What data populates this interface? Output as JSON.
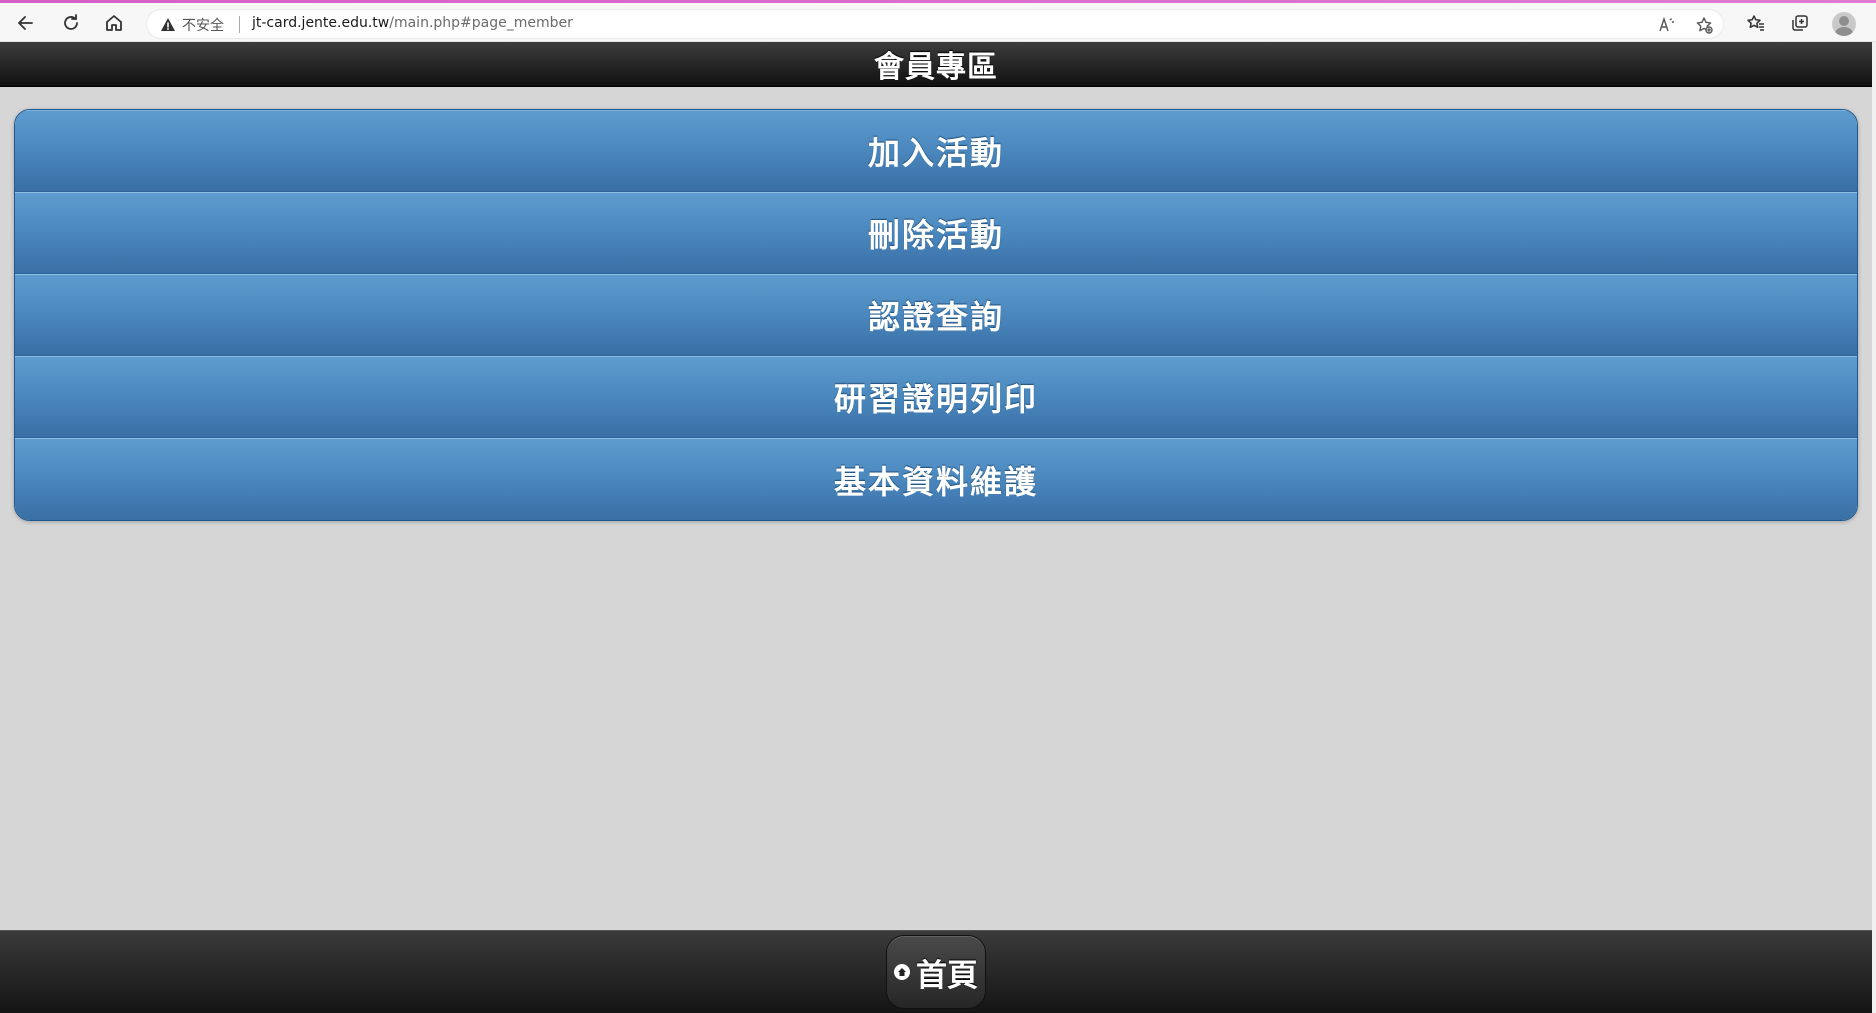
{
  "browser": {
    "security_label": "不安全",
    "url_host": "jt-card.jente.edu.tw",
    "url_path": "/main.php#page_member",
    "icons": {
      "back": "back-arrow-icon",
      "reload": "reload-icon",
      "home": "home-icon",
      "warning": "warning-icon",
      "read_aloud": "read-aloud-icon",
      "add_favorite": "add-favorite-icon",
      "favorites": "favorites-icon",
      "collections": "collections-icon",
      "profile": "profile-avatar"
    },
    "accent_color": "#d85ec8"
  },
  "header": {
    "title": "會員專區"
  },
  "menu": {
    "items": [
      {
        "label": "加入活動"
      },
      {
        "label": "刪除活動"
      },
      {
        "label": "認證查詢"
      },
      {
        "label": "研習證明列印"
      },
      {
        "label": "基本資料維護"
      }
    ],
    "color": "#4a87bd"
  },
  "footer": {
    "home_label": "首頁"
  }
}
